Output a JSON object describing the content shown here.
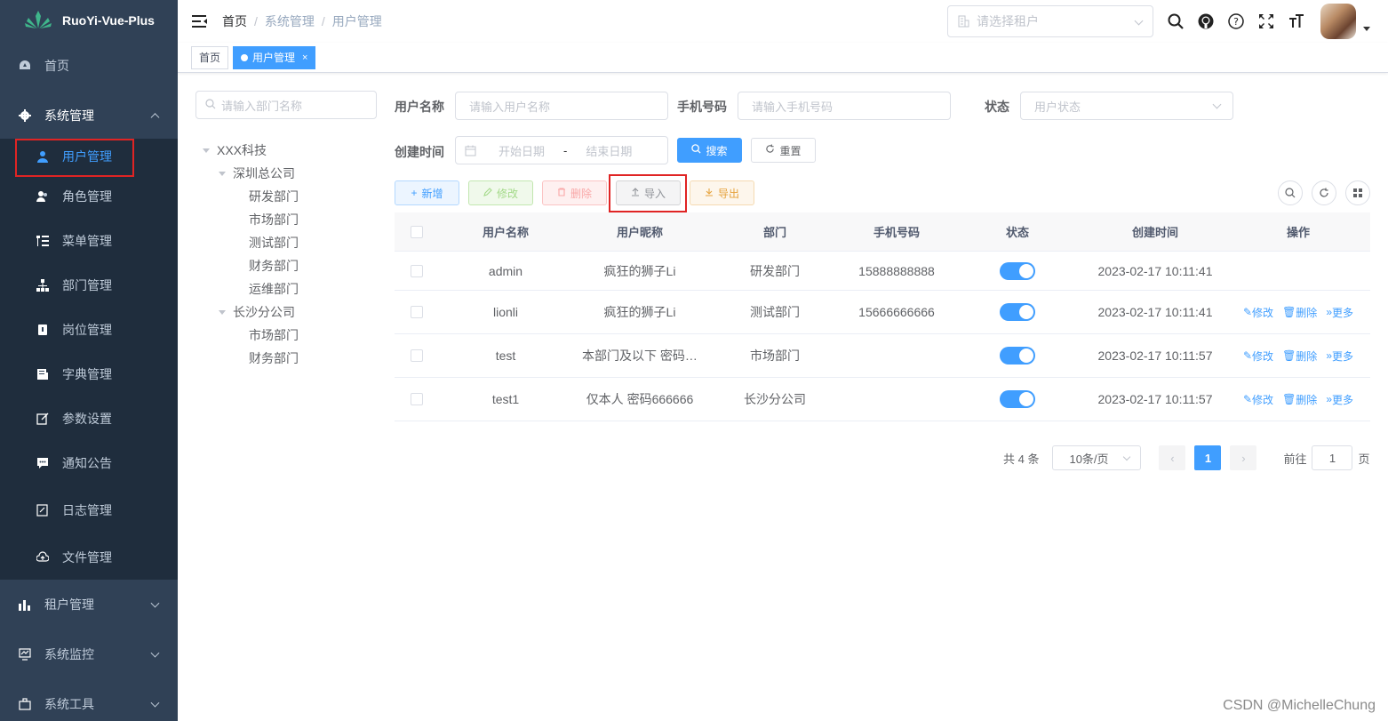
{
  "app": {
    "title": "RuoYi-Vue-Plus"
  },
  "sidebar": {
    "items": [
      {
        "label": "首页",
        "icon": "dashboard-icon"
      },
      {
        "label": "系统管理",
        "icon": "gear-icon",
        "expanded": true
      },
      {
        "label": "租户管理",
        "icon": "bar-chart-icon"
      },
      {
        "label": "系统监控",
        "icon": "monitor-icon"
      },
      {
        "label": "系统工具",
        "icon": "toolbox-icon"
      }
    ],
    "sub": [
      {
        "label": "用户管理",
        "icon": "user-icon",
        "active": true
      },
      {
        "label": "角色管理",
        "icon": "peoples-icon"
      },
      {
        "label": "菜单管理",
        "icon": "tree-table-icon"
      },
      {
        "label": "部门管理",
        "icon": "tree-icon"
      },
      {
        "label": "岗位管理",
        "icon": "post-icon"
      },
      {
        "label": "字典管理",
        "icon": "dict-icon"
      },
      {
        "label": "参数设置",
        "icon": "edit-icon"
      },
      {
        "label": "通知公告",
        "icon": "message-icon"
      },
      {
        "label": "日志管理",
        "icon": "log-icon"
      },
      {
        "label": "文件管理",
        "icon": "upload-icon"
      }
    ]
  },
  "navbar": {
    "breadcrumb": [
      "首页",
      "系统管理",
      "用户管理"
    ],
    "tenant_placeholder": "请选择租户"
  },
  "tags": [
    {
      "label": "首页"
    },
    {
      "label": "用户管理",
      "close": "×"
    }
  ],
  "dept": {
    "search_placeholder": "请输入部门名称",
    "tree": [
      {
        "label": "XXX科技",
        "level": 1
      },
      {
        "label": "深圳总公司",
        "level": 2
      },
      {
        "label": "研发部门",
        "level": 3
      },
      {
        "label": "市场部门",
        "level": 3
      },
      {
        "label": "测试部门",
        "level": 3
      },
      {
        "label": "财务部门",
        "level": 3
      },
      {
        "label": "运维部门",
        "level": 3
      },
      {
        "label": "长沙分公司",
        "level": 2
      },
      {
        "label": "市场部门",
        "level": 3
      },
      {
        "label": "财务部门",
        "level": 3
      }
    ]
  },
  "search": {
    "username_label": "用户名称",
    "username_placeholder": "请输入用户名称",
    "phone_label": "手机号码",
    "phone_placeholder": "请输入手机号码",
    "status_label": "状态",
    "status_placeholder": "用户状态",
    "time_label": "创建时间",
    "start_placeholder": "开始日期",
    "range_sep": "-",
    "end_placeholder": "结束日期",
    "search_btn": "搜索",
    "reset_btn": "重置"
  },
  "toolbar": {
    "add": "新增",
    "edit": "修改",
    "delete": "删除",
    "import": "导入",
    "export": "导出"
  },
  "table": {
    "headers": [
      "用户名称",
      "用户昵称",
      "部门",
      "手机号码",
      "状态",
      "创建时间",
      "操作"
    ],
    "rows": [
      {
        "username": "admin",
        "nickname": "疯狂的狮子Li",
        "dept": "研发部门",
        "phone": "15888888888",
        "status": true,
        "time": "2023-02-17 10:11:41",
        "ops": false
      },
      {
        "username": "lionli",
        "nickname": "疯狂的狮子Li",
        "dept": "测试部门",
        "phone": "15666666666",
        "status": true,
        "time": "2023-02-17 10:11:41",
        "ops": true
      },
      {
        "username": "test",
        "nickname": "本部门及以下 密码…",
        "dept": "市场部门",
        "phone": "",
        "status": true,
        "time": "2023-02-17 10:11:57",
        "ops": true
      },
      {
        "username": "test1",
        "nickname": "仅本人 密码666666",
        "dept": "长沙分公司",
        "phone": "",
        "status": true,
        "time": "2023-02-17 10:11:57",
        "ops": true
      }
    ],
    "op_edit": "修改",
    "op_delete": "删除",
    "op_more": "更多"
  },
  "pagination": {
    "total_text": "共 4 条",
    "page_size": "10条/页",
    "current_page": "1",
    "goto_label": "前往",
    "goto_value": "1",
    "page_unit": "页"
  },
  "watermark": "CSDN @MichelleChung",
  "colors": {
    "primary": "#409eff",
    "sidebar": "#304156",
    "submenu": "#1f2d3d",
    "highlight": "#e02424"
  }
}
